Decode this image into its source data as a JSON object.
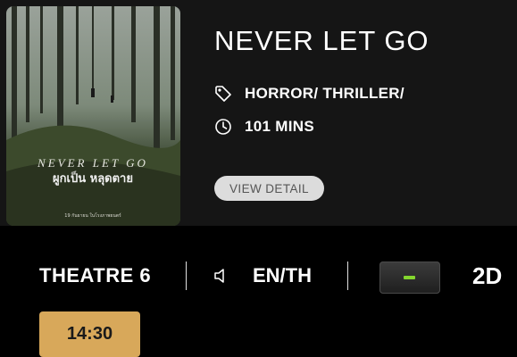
{
  "movie": {
    "title": "NEVER LET GO",
    "genre": "HORROR/ THRILLER/",
    "duration": "101 MINS",
    "detail_button": "VIEW DETAIL",
    "poster": {
      "title_text": "NEVER LET GO",
      "thai_title": "ผูกเป็น หลุดตาย",
      "release_line": "19 กันยายน ในโรงภาพยนตร์"
    }
  },
  "session": {
    "theatre": "THEATRE 6",
    "language": "EN/TH",
    "format": "2D",
    "times": [
      "14:30"
    ]
  },
  "colors": {
    "showtime_bg": "#d8a85a",
    "format_indicator": "#84d62e",
    "background": "#000000",
    "card": "#151515"
  },
  "icons": {
    "genre": "tag-icon",
    "duration": "clock-icon",
    "language": "speaker-icon"
  }
}
